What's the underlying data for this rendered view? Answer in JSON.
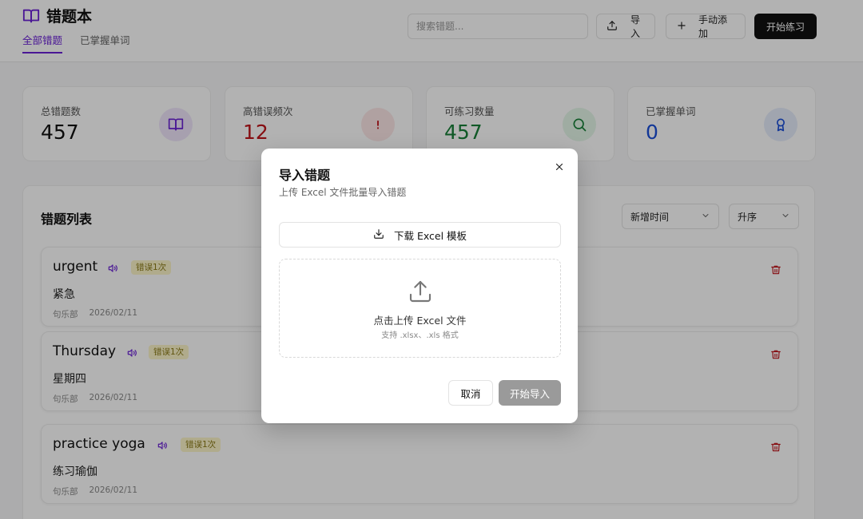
{
  "app": {
    "title": "错题本",
    "tabs": [
      {
        "label": "全部错题",
        "active": true
      },
      {
        "label": "已掌握单词",
        "active": false
      }
    ]
  },
  "toolbar": {
    "search_placeholder": "搜索错题...",
    "import_label": "导入",
    "add_label": "手动添加",
    "start_label": "开始练习"
  },
  "stats": [
    {
      "label": "总错题数",
      "value": "457",
      "color": "#111111",
      "icon": "book-icon",
      "icon_bg": "#efe6fb",
      "icon_color": "#6b21d6"
    },
    {
      "label": "高错误频次",
      "value": "12",
      "color": "#c0151b",
      "icon": "exclamation-icon",
      "icon_bg": "#fde7e7",
      "icon_color": "#c0151b"
    },
    {
      "label": "可练习数量",
      "value": "457",
      "color": "#188038",
      "icon": "search-icon",
      "icon_bg": "#e4f6e9",
      "icon_color": "#188038"
    },
    {
      "label": "已掌握单词",
      "value": "0",
      "color": "#1b4fd8",
      "icon": "award-icon",
      "icon_bg": "#e6ecfb",
      "icon_color": "#1b4fd8"
    }
  ],
  "list": {
    "title": "错题列表",
    "sort_value": "新增时间",
    "order_value": "升序",
    "items": [
      {
        "word": "urgent",
        "badge": "错误1次",
        "meaning": "紧急",
        "source": "句乐部",
        "date": "2026/02/11"
      },
      {
        "word": "Thursday",
        "badge": "错误1次",
        "meaning": "星期四",
        "source": "句乐部",
        "date": "2026/02/11"
      },
      {
        "word": "practice yoga",
        "badge": "错误1次",
        "meaning": "练习瑜伽",
        "source": "句乐部",
        "date": "2026/02/11"
      }
    ]
  },
  "modal": {
    "title": "导入错题",
    "subtitle": "上传 Excel 文件批量导入错题",
    "download_label": "下载 Excel 模板",
    "upload_label": "点击上传 Excel 文件",
    "upload_hint": "支持 .xlsx、.xls 格式",
    "cancel_label": "取消",
    "import_label": "开始导入"
  },
  "colors": {
    "accent": "#6b21d6",
    "danger": "#c0151b",
    "badge_bg": "#fdf5c9"
  }
}
